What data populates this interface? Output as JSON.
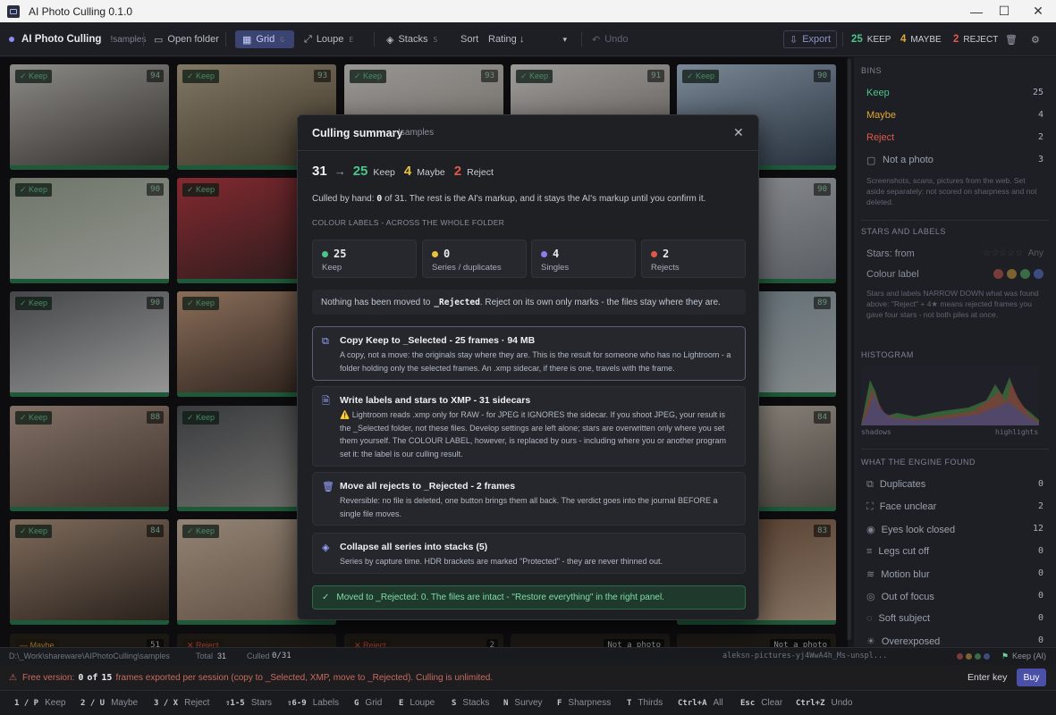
{
  "window": {
    "title": "AI Photo Culling 0.1.0",
    "minimize": "—",
    "maximize": "☐",
    "close": "✕"
  },
  "toolbar": {
    "app_name": "AI Photo Culling",
    "folder_name": "!samples",
    "open_folder": "Open folder",
    "grid": "Grid",
    "grid_key": "G",
    "loupe": "Loupe",
    "loupe_key": "E",
    "stacks": "Stacks",
    "stacks_key": "S",
    "sort_label": "Sort",
    "sort_value": "Rating ↓",
    "undo": "Undo",
    "export": "Export",
    "keep_count": "25",
    "keep_label": "KEEP",
    "maybe_count": "4",
    "maybe_label": "MAYBE",
    "reject_count": "2",
    "reject_label": "REJECT"
  },
  "grid": {
    "thumbnails": [
      {
        "tag": "✓ Keep",
        "score": "94",
        "c1": "#d8d5cf",
        "c2": "#4a4640"
      },
      {
        "tag": "✓ Keep",
        "score": "93",
        "c1": "#c7b79a",
        "c2": "#5a4e3a"
      },
      {
        "tag": "✓ Keep",
        "score": "93",
        "c1": "#e9e6e1",
        "c2": "#a9a39a"
      },
      {
        "tag": "✓ Keep",
        "score": "91",
        "c1": "#efece8",
        "c2": "#8f8a83"
      },
      {
        "tag": "✓ Keep",
        "score": "90",
        "c1": "#bcd0e6",
        "c2": "#3a4a5c"
      },
      {
        "tag": "✓ Keep",
        "score": "90",
        "c1": "#a9b4a0",
        "c2": "#e3e6e0"
      },
      {
        "tag": "✓ Keep",
        "score": "",
        "c1": "#c9404a",
        "c2": "#3a2a2a"
      },
      {
        "tag": "",
        "score": "90",
        "c1": "#d9dde2",
        "c2": "#8a9099"
      },
      {
        "tag": "✓ Keep",
        "score": "90",
        "c1": "#6a6c70",
        "c2": "#e8e8e8"
      },
      {
        "tag": "✓ Keep",
        "score": "",
        "c1": "#d4a98a",
        "c2": "#3a2c26"
      },
      {
        "tag": "",
        "score": "89",
        "c1": "#8fa4b0",
        "c2": "#cfd6d8"
      },
      {
        "tag": "✓ Keep",
        "score": "88",
        "c1": "#c8ad9c",
        "c2": "#5c4a40"
      },
      {
        "tag": "✓ Keep",
        "score": "",
        "c1": "#585a5e",
        "c2": "#b5b3af"
      },
      {
        "tag": "",
        "score": "84",
        "c1": "#e4d9cc",
        "c2": "#6e655c"
      },
      {
        "tag": "✓ Keep",
        "score": "84",
        "c1": "#c2a48c",
        "c2": "#3c3029"
      },
      {
        "tag": "✓ Keep",
        "score": "",
        "c1": "#e1cbb5",
        "c2": "#8c7360"
      },
      {
        "tag": "",
        "score": "83",
        "c1": "#7a5640",
        "c2": "#d3b79d"
      }
    ],
    "bottom_row": [
      {
        "tag": "— Maybe",
        "score": "51"
      },
      {
        "tag": "✕ Reject",
        "score": ""
      },
      {
        "tag": "✕ Reject",
        "score": "2"
      },
      {
        "tag": "",
        "score": "Not a photo"
      },
      {
        "tag": "",
        "score": "Not a photo"
      }
    ]
  },
  "right": {
    "bins_header": "BINS",
    "bins": [
      {
        "label": "Keep",
        "count": "25",
        "color": "#4fc48a"
      },
      {
        "label": "Maybe",
        "count": "4",
        "color": "#e0a63a"
      },
      {
        "label": "Reject",
        "count": "2",
        "color": "#e0584a"
      },
      {
        "label": "Not a photo",
        "count": "3",
        "color": "#9aa0ab"
      }
    ],
    "bins_note": "Screenshots, scans, pictures from the web. Set aside separately: not scored on sharpness and not deleted.",
    "stars_header": "STARS AND LABELS",
    "stars_from": "Stars: from",
    "stars_any": "Any",
    "colour_label": "Colour label",
    "stars_note": "Stars and labels NARROW DOWN what was found above: \"Reject\" + 4★ means rejected frames you gave four stars - not both piles at once.",
    "histogram_header": "HISTOGRAM",
    "hist_shadows": "shadows",
    "hist_highlights": "highlights",
    "engine_header": "WHAT THE ENGINE FOUND",
    "engine": [
      {
        "label": "Duplicates",
        "count": "0",
        "icon": "⧉"
      },
      {
        "label": "Face unclear",
        "count": "2",
        "icon": "⛶"
      },
      {
        "label": "Eyes look closed",
        "count": "12",
        "icon": "◉"
      },
      {
        "label": "Legs cut off",
        "count": "0",
        "icon": "≡"
      },
      {
        "label": "Motion blur",
        "count": "0",
        "icon": "≋"
      },
      {
        "label": "Out of focus",
        "count": "0",
        "icon": "◎"
      },
      {
        "label": "Soft subject",
        "count": "0",
        "icon": "◌"
      },
      {
        "label": "Overexposed",
        "count": "0",
        "icon": "☀"
      }
    ]
  },
  "status": {
    "path": "D:\\_Work\\shareware\\AIPhotoCulling\\samples",
    "total_label": "Total",
    "total": "31",
    "culled_label": "Culled",
    "culled": "0/31",
    "filename": "aleksn-pictures-yj4WwA4h_Ms-unspl...",
    "keep_ai": "Keep (AI)"
  },
  "warn": {
    "text_a": "Free version:",
    "n1": "0",
    "of": "of",
    "n2": "15",
    "text_b": "frames exported per session (copy to _Selected, XMP, move to _Rejected). Culling is unlimited.",
    "enter_key": "Enter key",
    "buy": "Buy"
  },
  "keys": [
    {
      "k": "1 / P",
      "l": "Keep"
    },
    {
      "k": "2 / U",
      "l": "Maybe"
    },
    {
      "k": "3 / X",
      "l": "Reject"
    },
    {
      "k": "⇧1-5",
      "l": "Stars"
    },
    {
      "k": "⇧6-9",
      "l": "Labels"
    },
    {
      "k": "G",
      "l": "Grid"
    },
    {
      "k": "E",
      "l": "Loupe"
    },
    {
      "k": "S",
      "l": "Stacks"
    },
    {
      "k": "N",
      "l": "Survey"
    },
    {
      "k": "F",
      "l": "Sharpness"
    },
    {
      "k": "T",
      "l": "Thirds"
    },
    {
      "k": "Ctrl+A",
      "l": "All"
    },
    {
      "k": "Esc",
      "l": "Clear"
    },
    {
      "k": "Ctrl+Z",
      "l": "Undo"
    }
  ],
  "modal": {
    "title": "Culling summary",
    "subtitle": "· !samples",
    "total": "31",
    "arrow": "→",
    "keep_n": "25",
    "keep_l": "Keep",
    "maybe_n": "4",
    "maybe_l": "Maybe",
    "reject_n": "2",
    "reject_l": "Reject",
    "culled_a": "Culled by hand:",
    "culled_n": "0",
    "culled_b": "of 31. The rest is the AI's markup, and it stays the AI's markup until you confirm it.",
    "labels_header": "COLOUR LABELS - ACROSS THE WHOLE FOLDER",
    "cards": [
      {
        "value": "25",
        "label": "Keep",
        "color": "#4fc48a"
      },
      {
        "value": "0",
        "label": "Series / duplicates",
        "color": "#e6c23f"
      },
      {
        "value": "4",
        "label": "Singles",
        "color": "#8a7cf0"
      },
      {
        "value": "2",
        "label": "Rejects",
        "color": "#e0584a"
      }
    ],
    "notice_a": "Nothing has been moved to",
    "notice_code": "_Rejected",
    "notice_b": ". Reject on its own only marks - the files stay where they are.",
    "actions": [
      {
        "icon": "⧉",
        "title": "Copy Keep to _Selected - 25 frames · 94 MB",
        "desc": "A copy, not a move: the originals stay where they are. This is the result for someone who has no Lightroom - a folder holding only the selected frames. An .xmp sidecar, if there is one, travels with the frame."
      },
      {
        "icon": "🗎",
        "title": "Write labels and stars to XMP - 31 sidecars",
        "desc": "⚠️ Lightroom reads .xmp only for RAW - for JPEG it IGNORES the sidecar. If you shoot JPEG, your result is the _Selected folder, not these files. Develop settings are left alone; stars are overwritten only where you set them yourself. The COLOUR LABEL, however, is replaced by ours - including where you or another program set it: the label is our culling result."
      },
      {
        "icon": "🗑",
        "title": "Move all rejects to _Rejected - 2 frames",
        "desc": "Reversible: no file is deleted, one button brings them all back. The verdict goes into the journal BEFORE a single file moves."
      },
      {
        "icon": "◈",
        "title": "Collapse all series into stacks (5)",
        "desc": "Series by capture time. HDR brackets are marked \"Protected\" - they are never thinned out."
      }
    ],
    "success": "Moved to _Rejected: 0. The files are intact - \"Restore everything\" in the right panel."
  }
}
